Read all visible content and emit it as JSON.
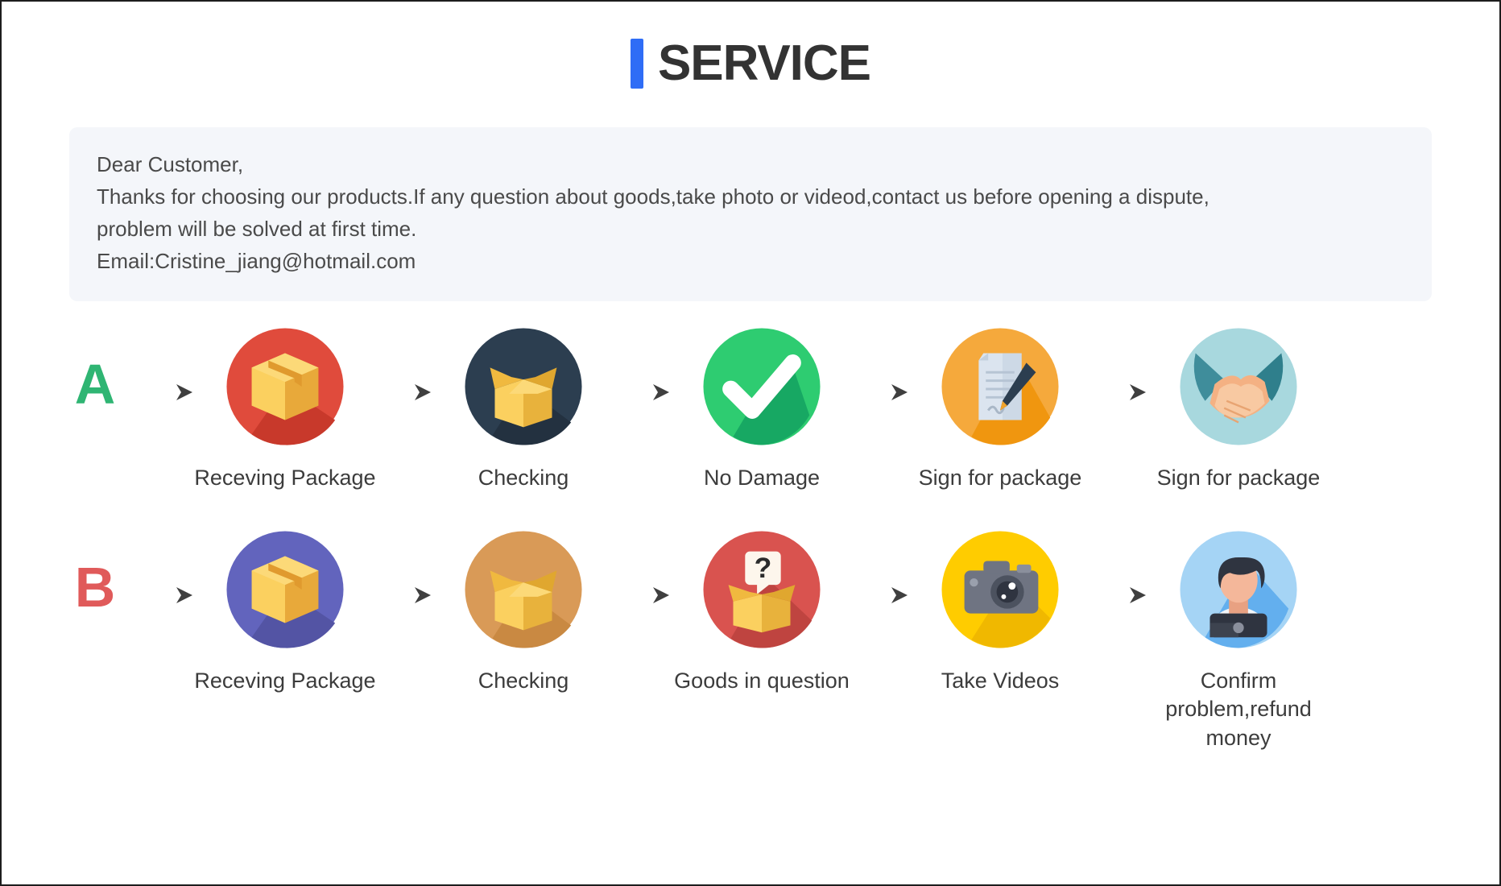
{
  "header": {
    "accent_color": "#2f6df6",
    "title": "SERVICE"
  },
  "notice": {
    "line1": "Dear Customer,",
    "line2": "Thanks for choosing our products.If any question about goods,take photo or videod,contact us before opening a dispute,",
    "line3": "problem will be solved at first time.",
    "line4": "Email:Cristine_jiang@hotmail.com"
  },
  "flows": [
    {
      "letter": "A",
      "letter_color": "#2fb573",
      "steps": [
        {
          "label": "Receving Package",
          "icon": "closed-box-icon",
          "circle_color": "#e04b3c"
        },
        {
          "label": "Checking",
          "icon": "open-box-icon",
          "circle_color": "#2c3e50"
        },
        {
          "label": "No Damage",
          "icon": "check-mark-icon",
          "circle_color": "#2ecc71"
        },
        {
          "label": "Sign for package",
          "icon": "document-pen-icon",
          "circle_color": "#f5a93c"
        },
        {
          "label": "Sign for package",
          "icon": "handshake-icon",
          "circle_color": "#a8d8de"
        }
      ]
    },
    {
      "letter": "B",
      "letter_color": "#e05a5a",
      "steps": [
        {
          "label": "Receving Package",
          "icon": "closed-box-icon",
          "circle_color": "#6264bd"
        },
        {
          "label": "Checking",
          "icon": "open-box-icon",
          "circle_color": "#d99a57"
        },
        {
          "label": "Goods in question",
          "icon": "question-box-icon",
          "circle_color": "#d9534f"
        },
        {
          "label": "Take Videos",
          "icon": "camera-icon",
          "circle_color": "#ffcc00"
        },
        {
          "label": "Confirm problem,refund money",
          "icon": "support-agent-icon",
          "circle_color": "#a5d4f5"
        }
      ]
    }
  ]
}
